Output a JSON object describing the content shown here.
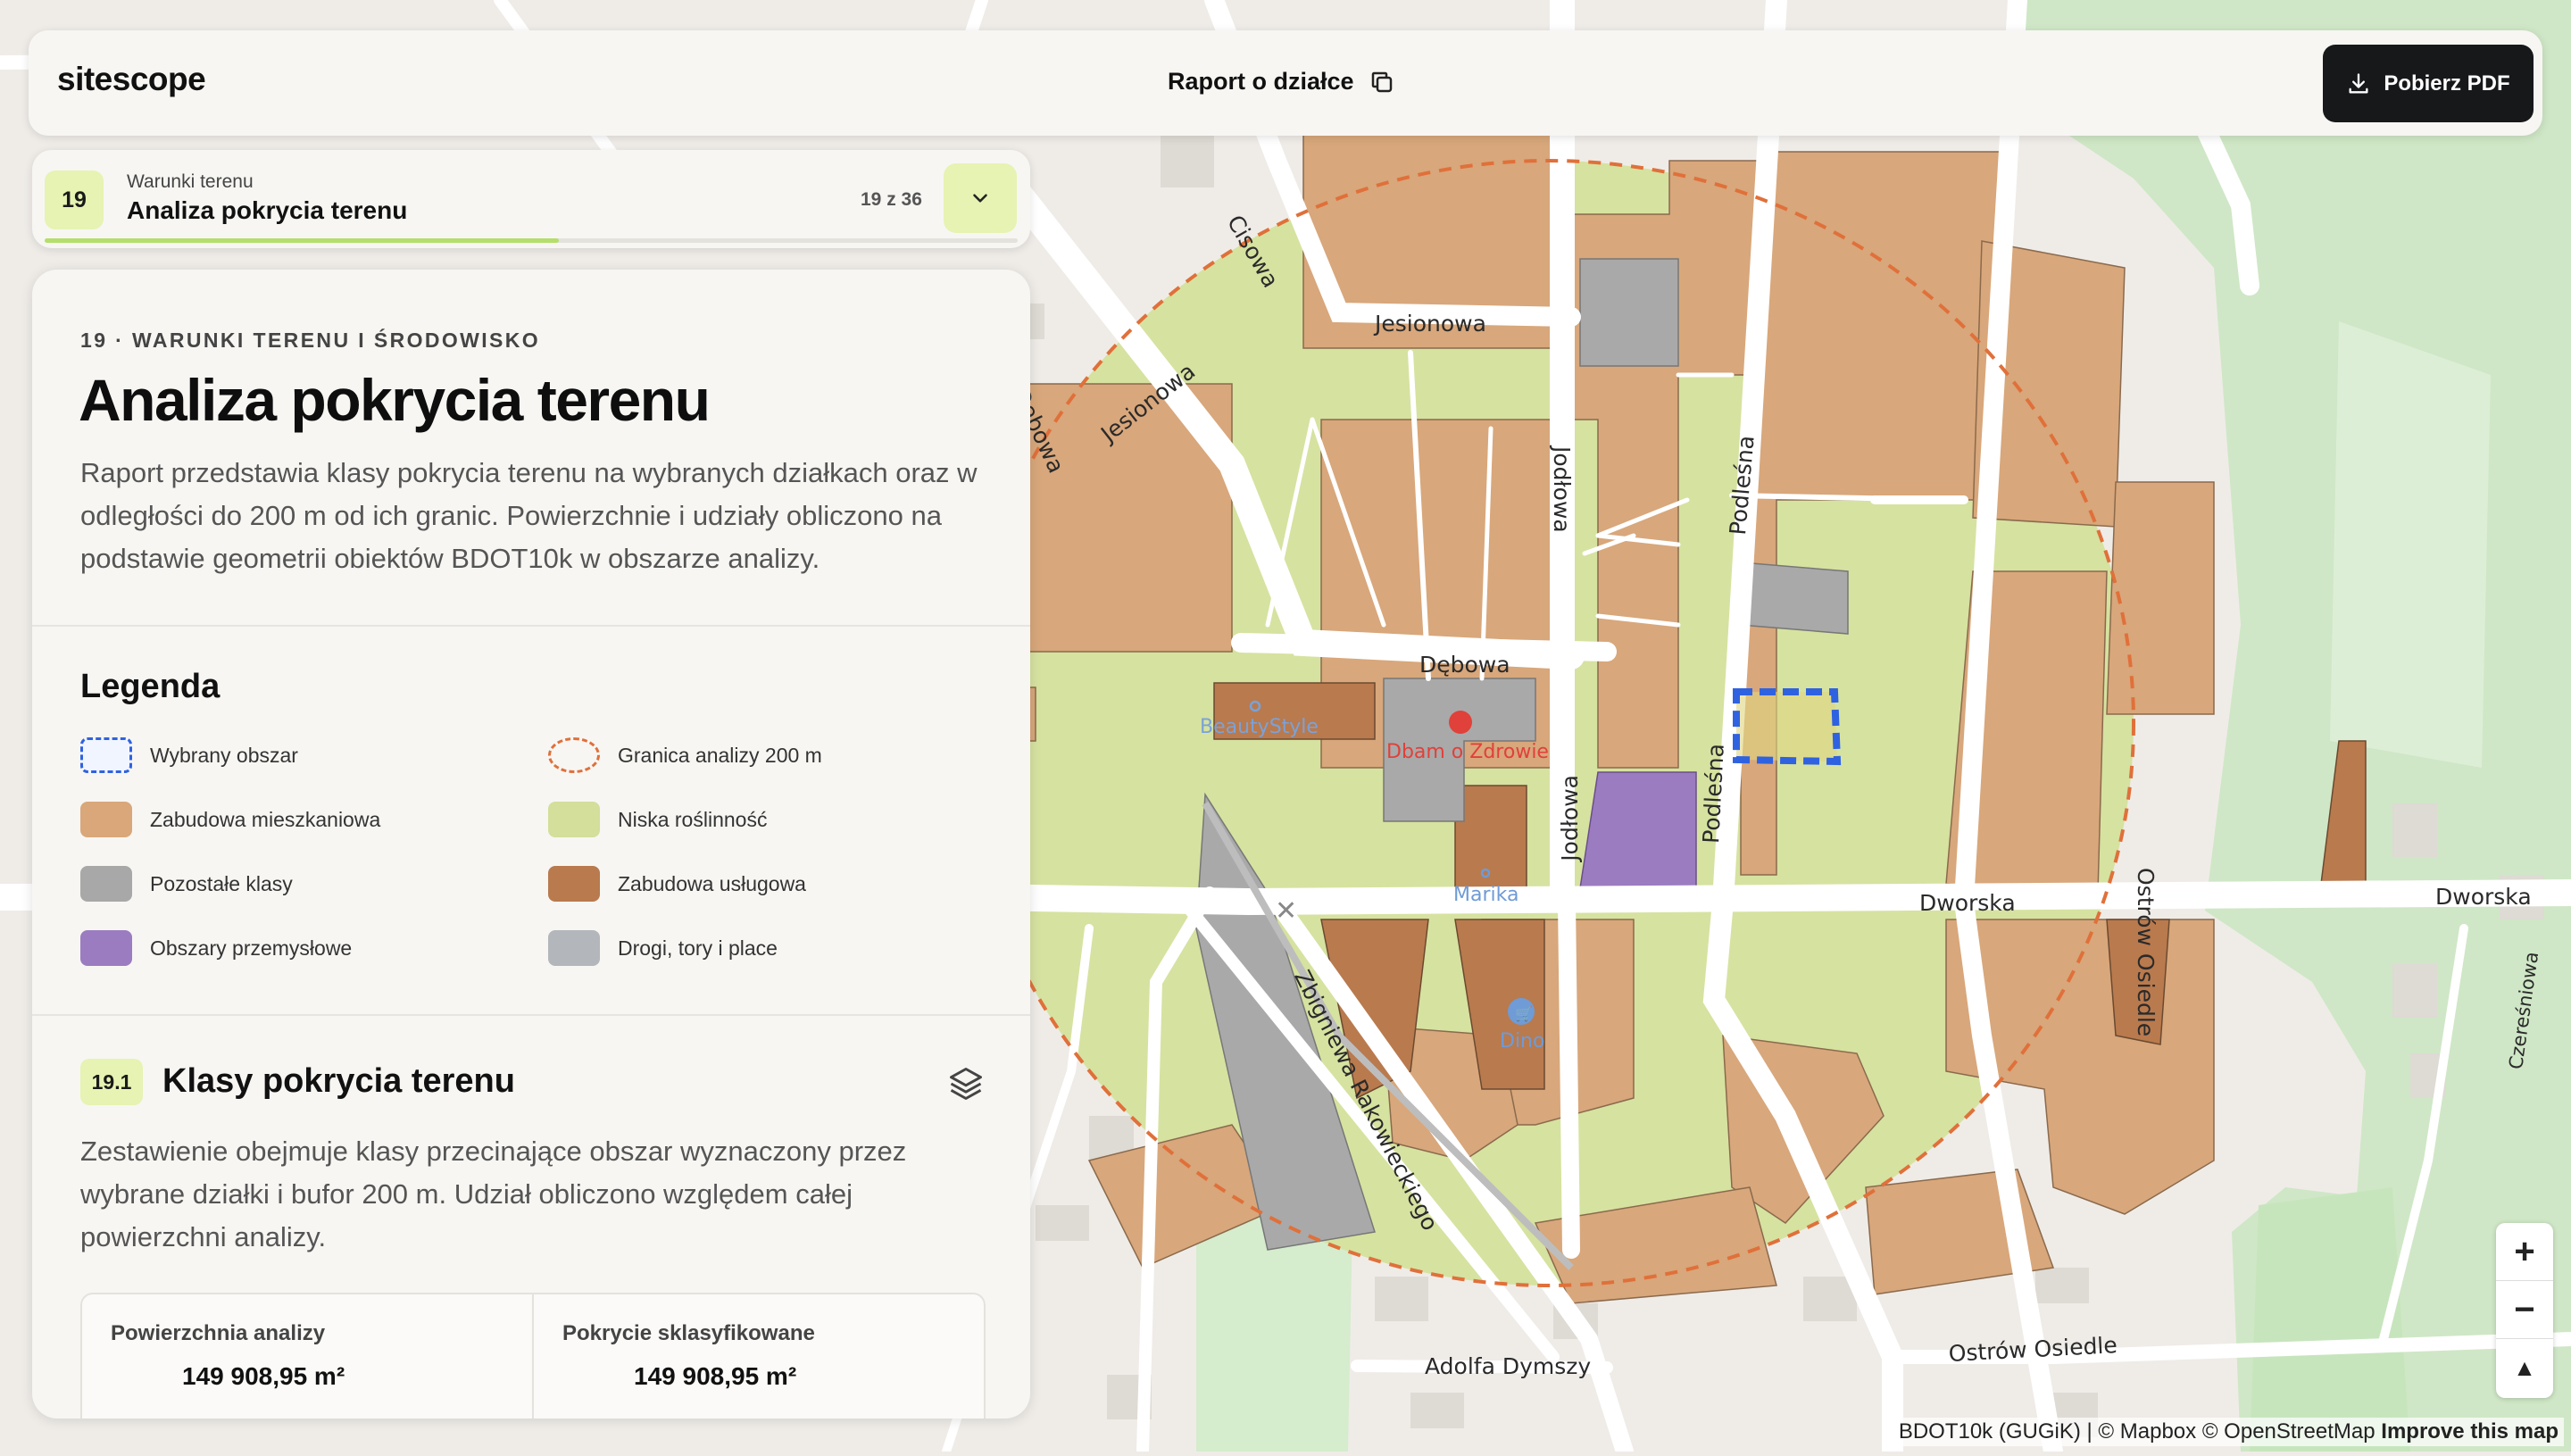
{
  "app": {
    "logo": "sitescope"
  },
  "header": {
    "report_title": "Raport o działce",
    "pdf_button": "Pobierz PDF"
  },
  "section_nav": {
    "number": "19",
    "category": "Warunki terenu",
    "title": "Analiza pokrycia terenu",
    "counter": "19 z 36",
    "progress": 0.528
  },
  "panel": {
    "eyebrow": "19 · WARUNKI TERENU I ŚRODOWISKO",
    "title": "Analiza pokrycia terenu",
    "intro": "Raport przedstawia klasy pokrycia terenu na wybranych działkach oraz w odległości do 200 m od ich granic. Powierzchnie i udziały obliczono na podstawie geometrii obiektów BDOT10k w obszarze analizy.",
    "legend_title": "Legenda",
    "legend": [
      {
        "label": "Wybrany obszar",
        "color": "#2f62e0",
        "style": "dashed-rect"
      },
      {
        "label": "Granica analizy 200 m",
        "color": "#e0703a",
        "style": "dashed-ellipse"
      },
      {
        "label": "Zabudowa mieszkaniowa",
        "color": "#d9a77a",
        "style": "fill"
      },
      {
        "label": "Niska roślinność",
        "color": "#d3df9a",
        "style": "fill"
      },
      {
        "label": "Pozostałe klasy",
        "color": "#a8a8a8",
        "style": "fill"
      },
      {
        "label": "Zabudowa usługowa",
        "color": "#b97a4e",
        "style": "fill"
      },
      {
        "label": "Obszary przemysłowe",
        "color": "#9b7cc0",
        "style": "fill"
      },
      {
        "label": "Drogi, tory i place",
        "color": "#b3b6ba",
        "style": "fill"
      }
    ],
    "subsection": {
      "number": "19.1",
      "title": "Klasy pokrycia terenu",
      "desc": "Zestawienie obejmuje klasy przecinające obszar wyznaczony przez wybrane działki i bufor 200 m. Udział obliczono względem całej powierzchni analizy.",
      "stats": [
        {
          "label": "Powierzchnia analizy",
          "value": "149 908,95 m²"
        },
        {
          "label": "Pokrycie sklasyfikowane",
          "value": "149 908,95 m²"
        }
      ]
    }
  },
  "map": {
    "streets": [
      "Jesionowa",
      "Jesionowa",
      "Dębowa",
      "Dębowa",
      "Cisowa",
      "Jodłowa",
      "Jodłowa",
      "Podleśna",
      "Podleśna",
      "Dworska",
      "Dworska",
      "Ostrów Osiedle",
      "Ostrów Osiedle",
      "Zbigniewa Rakowieckiego",
      "Adolfa Dymszy",
      "Czereśniowa"
    ],
    "pois": [
      {
        "name": "BeautyStyle",
        "color": "#7aa2d8"
      },
      {
        "name": "Dbam o Zdrowie",
        "color": "#e0413a"
      },
      {
        "name": "Marika",
        "color": "#6f9bd6"
      },
      {
        "name": "Dino",
        "color": "#6f9bd6"
      }
    ],
    "zoom_in": "+",
    "zoom_out": "−",
    "compass": "▲",
    "attribution_source": "BDOT10k (GUGiK)",
    "attribution_rest": "| © Mapbox © OpenStreetMap",
    "attribution_link": "Improve this map"
  }
}
